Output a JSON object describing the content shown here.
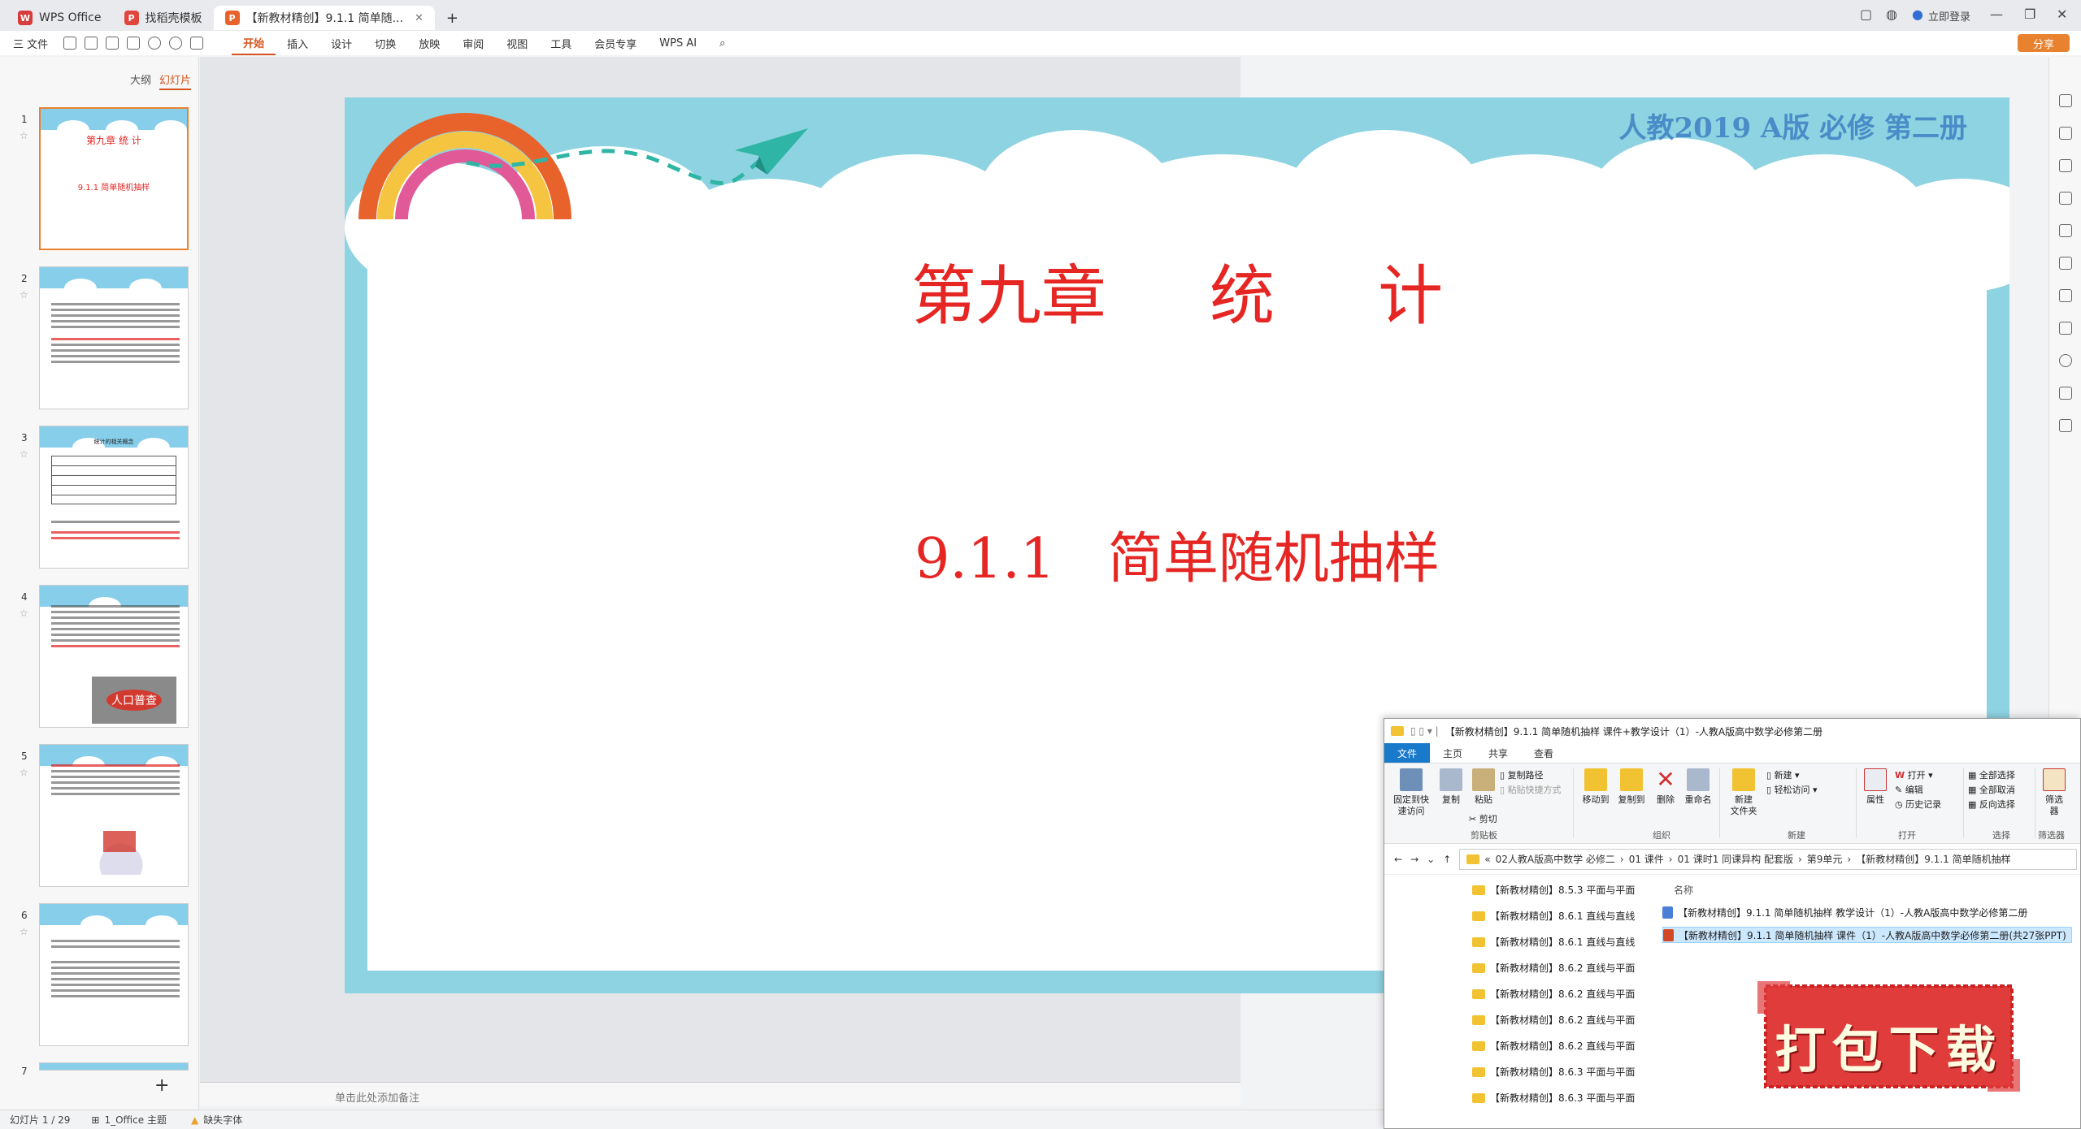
{
  "titlebar": {
    "tabs": [
      {
        "label": "WPS Office",
        "color": "#d83b3b",
        "logo": "W"
      },
      {
        "label": "找稻壳模板",
        "color": "#e0463e",
        "logo": "P"
      },
      {
        "label": "【新教材精创】9.1.1 简单随...",
        "color": "#e8622c",
        "logo": "P"
      }
    ],
    "login": "立即登录"
  },
  "menubar": {
    "file": "三 文件",
    "items": [
      "开始",
      "插入",
      "设计",
      "切换",
      "放映",
      "审阅",
      "视图",
      "工具",
      "会员专享",
      "WPS AI"
    ],
    "share": "分享"
  },
  "leftpanel": {
    "tab_outline": "大纲",
    "tab_slides": "幻灯片",
    "add": "+",
    "slides": [
      {
        "num": "1",
        "title": "第九章   统   计",
        "subtitle": "9.1.1  简单随机抽样"
      },
      {
        "num": "2"
      },
      {
        "num": "3",
        "title": "统计的相关概念"
      },
      {
        "num": "4",
        "title": "人口普查"
      },
      {
        "num": "5"
      },
      {
        "num": "6"
      },
      {
        "num": "7"
      }
    ]
  },
  "slide": {
    "header": "人教2019 A版 必修 第二册",
    "title": "第九章     统     计",
    "subtitle": "9.1.1   简单随机抽样",
    "sky_color": "#8ed3e2",
    "title_color": "#e52623",
    "header_color": "#4a8cc7"
  },
  "notes_placeholder": "单击此处添加备注",
  "statusbar": {
    "slide_count": "幻灯片 1 / 29",
    "theme": "1_Office 主题",
    "missing_font": "缺失字体"
  },
  "explorer": {
    "title": "【新教材精创】9.1.1 简单随机抽样 课件+教学设计（1）-人教A版高中数学必修第二册",
    "tabs": [
      "文件",
      "主页",
      "共享",
      "查看"
    ],
    "ribbon": {
      "pin": "固定到快\n速访问",
      "copy": "复制",
      "paste": "粘贴",
      "copy_path": "复制路径",
      "paste_shortcut": "粘贴快捷方式",
      "cut": "剪切",
      "clipboard": "剪贴板",
      "move_to": "移动到",
      "copy_to": "复制到",
      "delete": "删除",
      "rename": "重命名",
      "organize": "组织",
      "new_folder": "新建\n文件夹",
      "new_item": "新建 ▾",
      "easy_access": "轻松访问 ▾",
      "new": "新建",
      "properties": "属性",
      "open": "打开 ▾",
      "edit": "编辑",
      "history": "历史记录",
      "open_group": "打开",
      "select_all": "全部选择",
      "select_none": "全部取消",
      "invert": "反向选择",
      "select_group": "选择",
      "filter": "筛选\n器",
      "filter_group": "筛选器"
    },
    "breadcrumb": [
      "«",
      "02人教A版高中数学 必修二",
      "›",
      "01 课件",
      "›",
      "01 课时1 同课异构 配套版",
      "›",
      "第9单元",
      "›",
      "【新教材精创】9.1.1 简单随机抽样"
    ],
    "nav_items": [
      "【新教材精创】8.5.3 平面与平面",
      "【新教材精创】8.6.1 直线与直线",
      "【新教材精创】8.6.1 直线与直线",
      "【新教材精创】8.6.2 直线与平面",
      "【新教材精创】8.6.2 直线与平面",
      "【新教材精创】8.6.2 直线与平面",
      "【新教材精创】8.6.2 直线与平面",
      "【新教材精创】8.6.3 平面与平面",
      "【新教材精创】8.6.3 平面与平面"
    ],
    "column_name": "名称",
    "files": [
      {
        "name": "【新教材精创】9.1.1 简单随机抽样 教学设计（1）-人教A版高中数学必修第二册",
        "type": "doc"
      },
      {
        "name": "【新教材精创】9.1.1 简单随机抽样 课件（1）-人教A版高中数学必修第二册(共27张PPT)",
        "type": "ppt"
      }
    ]
  },
  "download_badge": {
    "text": "打包下载",
    "color": "#e03c3c"
  }
}
